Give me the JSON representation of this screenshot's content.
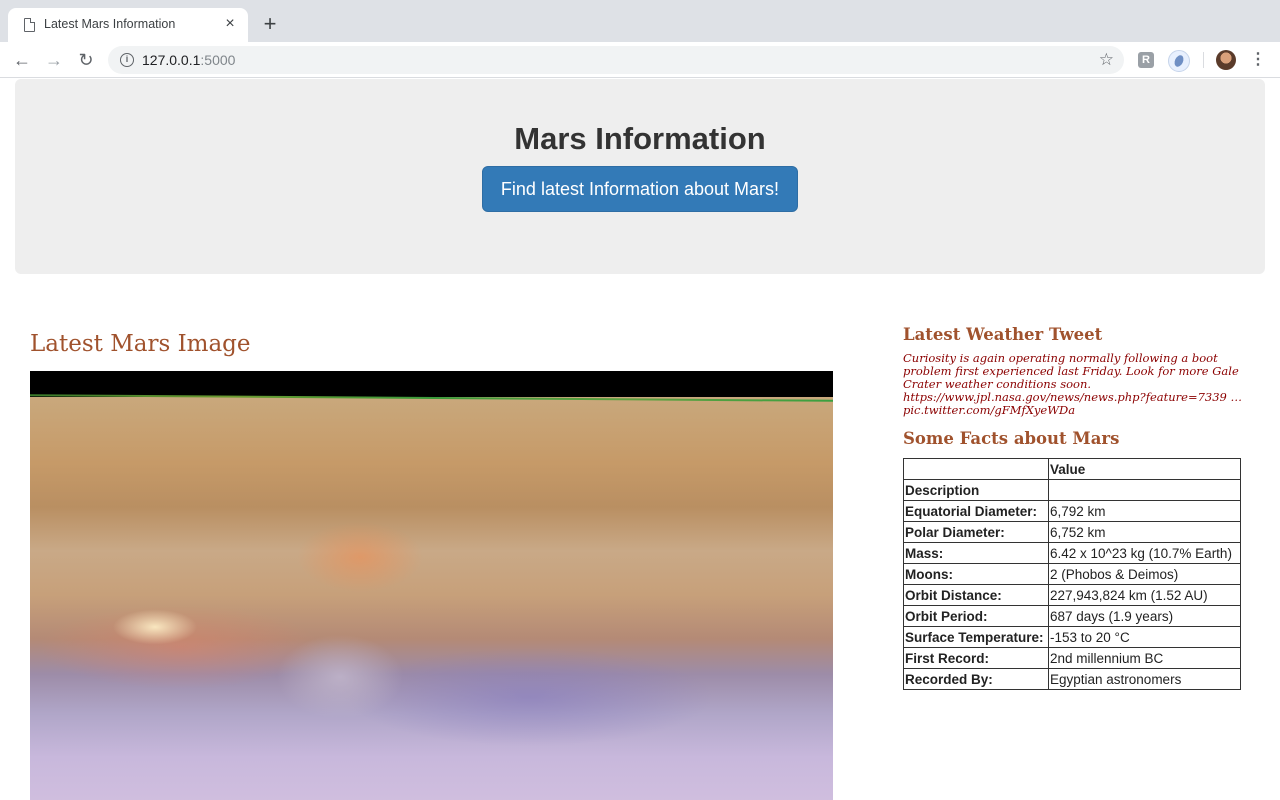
{
  "browser": {
    "tab_title": "Latest Mars Information",
    "tab_close": "×",
    "new_tab": "+",
    "url_host": "127.0.0.1",
    "url_port": ":5000"
  },
  "header": {
    "title": "Mars Information",
    "button_label": "Find latest Information about Mars!"
  },
  "image_section": {
    "heading": "Latest Mars Image"
  },
  "weather": {
    "heading": "Latest Weather Tweet",
    "text": "Curiosity is again operating normally following a boot problem first experienced last Friday. Look for more Gale Crater weather conditions soon. https://www.jpl.nasa.gov/news/news.php?feature=7339 … pic.twitter.com/gFMfXyeWDa"
  },
  "facts": {
    "heading": "Some Facts about Mars",
    "columns": [
      "",
      "Value"
    ],
    "rows": [
      {
        "label": "Description",
        "value": ""
      },
      {
        "label": "Equatorial Diameter:",
        "value": "6,792 km"
      },
      {
        "label": "Polar Diameter:",
        "value": "6,752 km"
      },
      {
        "label": "Mass:",
        "value": "6.42 x 10^23 kg (10.7% Earth)"
      },
      {
        "label": "Moons:",
        "value": "2 (Phobos & Deimos)"
      },
      {
        "label": "Orbit Distance:",
        "value": "227,943,824 km (1.52 AU)"
      },
      {
        "label": "Orbit Period:",
        "value": "687 days (1.9 years)"
      },
      {
        "label": "Surface Temperature:",
        "value": "-153 to 20 °C"
      },
      {
        "label": "First Record:",
        "value": "2nd millennium BC"
      },
      {
        "label": "Recorded By:",
        "value": "Egyptian astronomers"
      }
    ]
  },
  "colors": {
    "heading_accent": "#a0522d",
    "tweet_text": "#8b0000",
    "button_bg": "#337ab7",
    "jumbotron_bg": "#eeeeee"
  }
}
